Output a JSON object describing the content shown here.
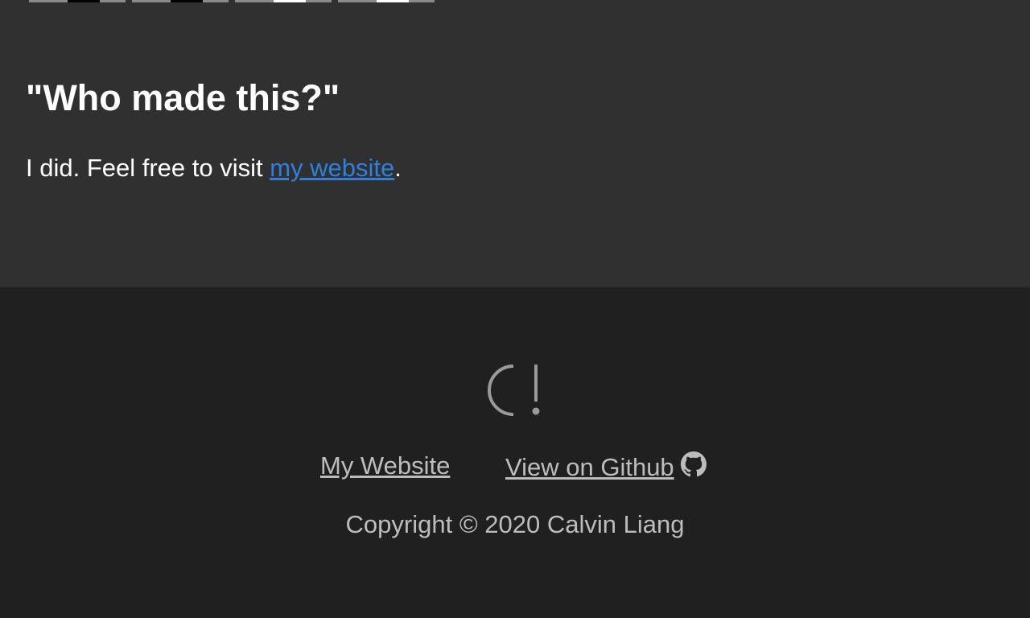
{
  "about": {
    "heading": "\"Who made this?\"",
    "text_before": "I did. Feel free to visit ",
    "link_text": "my website",
    "text_after": "."
  },
  "footer": {
    "logo_icon": "calvin-logo-icon",
    "links": {
      "website": "My Website",
      "github": "View on Github "
    },
    "github_icon": "github-icon",
    "copyright": "Copyright © 2020 Calvin Liang"
  },
  "colors": {
    "top_bg": "#303030",
    "footer_bg": "#202020",
    "link": "#2f7fe0",
    "footer_text": "#bdbdbd"
  }
}
